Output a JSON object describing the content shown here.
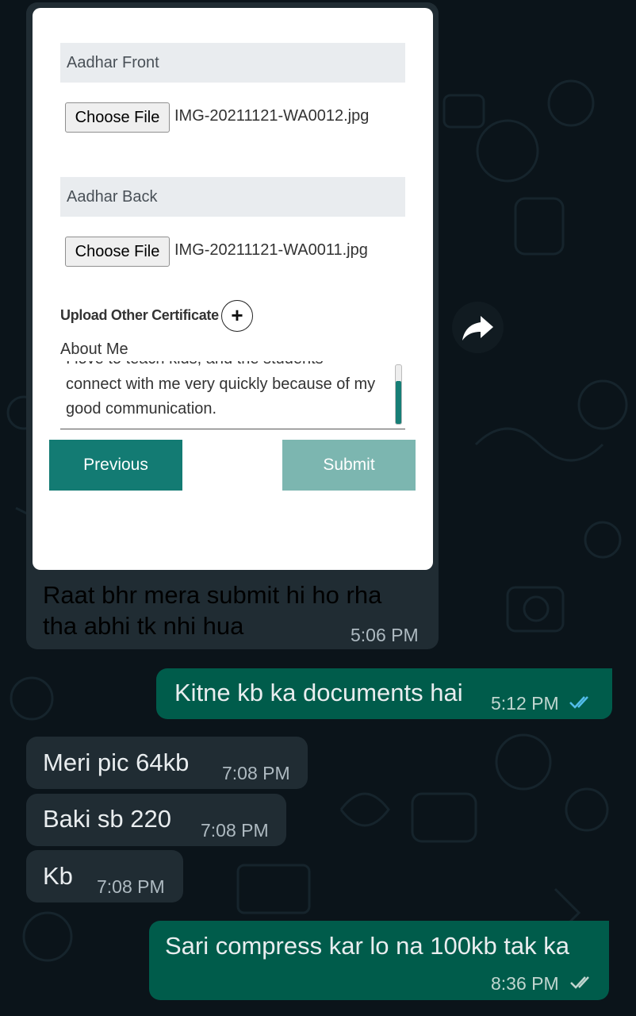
{
  "card": {
    "aadhar_front_label": "Aadhar Front",
    "aadhar_back_label": "Aadhar Back",
    "choose_file_label": "Choose File",
    "front_file_name": "IMG-20211121-WA0012.jpg",
    "back_file_name": "IMG-20211121-WA0011.jpg",
    "upload_other_label": "Upload Other Certificate",
    "plus_glyph": "+",
    "about_label": "About Me",
    "about_partial_line": "I love to teach kids, and the students",
    "about_line_2": "connect with me very quickly because of my",
    "about_line_3": "good communication.",
    "previous_label": "Previous",
    "submit_label": "Submit"
  },
  "messages": [
    {
      "dir": "in",
      "lines": [
        "Raat bhr mera submit hi ho rha",
        "tha abhi tk nhi hua"
      ],
      "time": "5:06 PM"
    },
    {
      "dir": "out",
      "text": "Kitne kb ka documents hai",
      "time": "5:12 PM",
      "status": "read"
    },
    {
      "dir": "in",
      "text": "Meri pic 64kb",
      "time": "7:08 PM"
    },
    {
      "dir": "in",
      "text": "Baki sb 220",
      "time": "7:08 PM"
    },
    {
      "dir": "in",
      "text": "Kb",
      "time": "7:08 PM"
    },
    {
      "dir": "out",
      "text": "Sari compress kar lo na 100kb tak ka",
      "time": "8:36 PM",
      "status": "delivered"
    }
  ],
  "icons": {
    "forward": "forward-arrow-icon",
    "double_tick": "double-check-icon"
  },
  "colors": {
    "background": "#0b141a",
    "incoming": "#202c33",
    "outgoing": "#005c4b",
    "read_tick": "#53bdeb",
    "primary_button": "#137b73"
  }
}
